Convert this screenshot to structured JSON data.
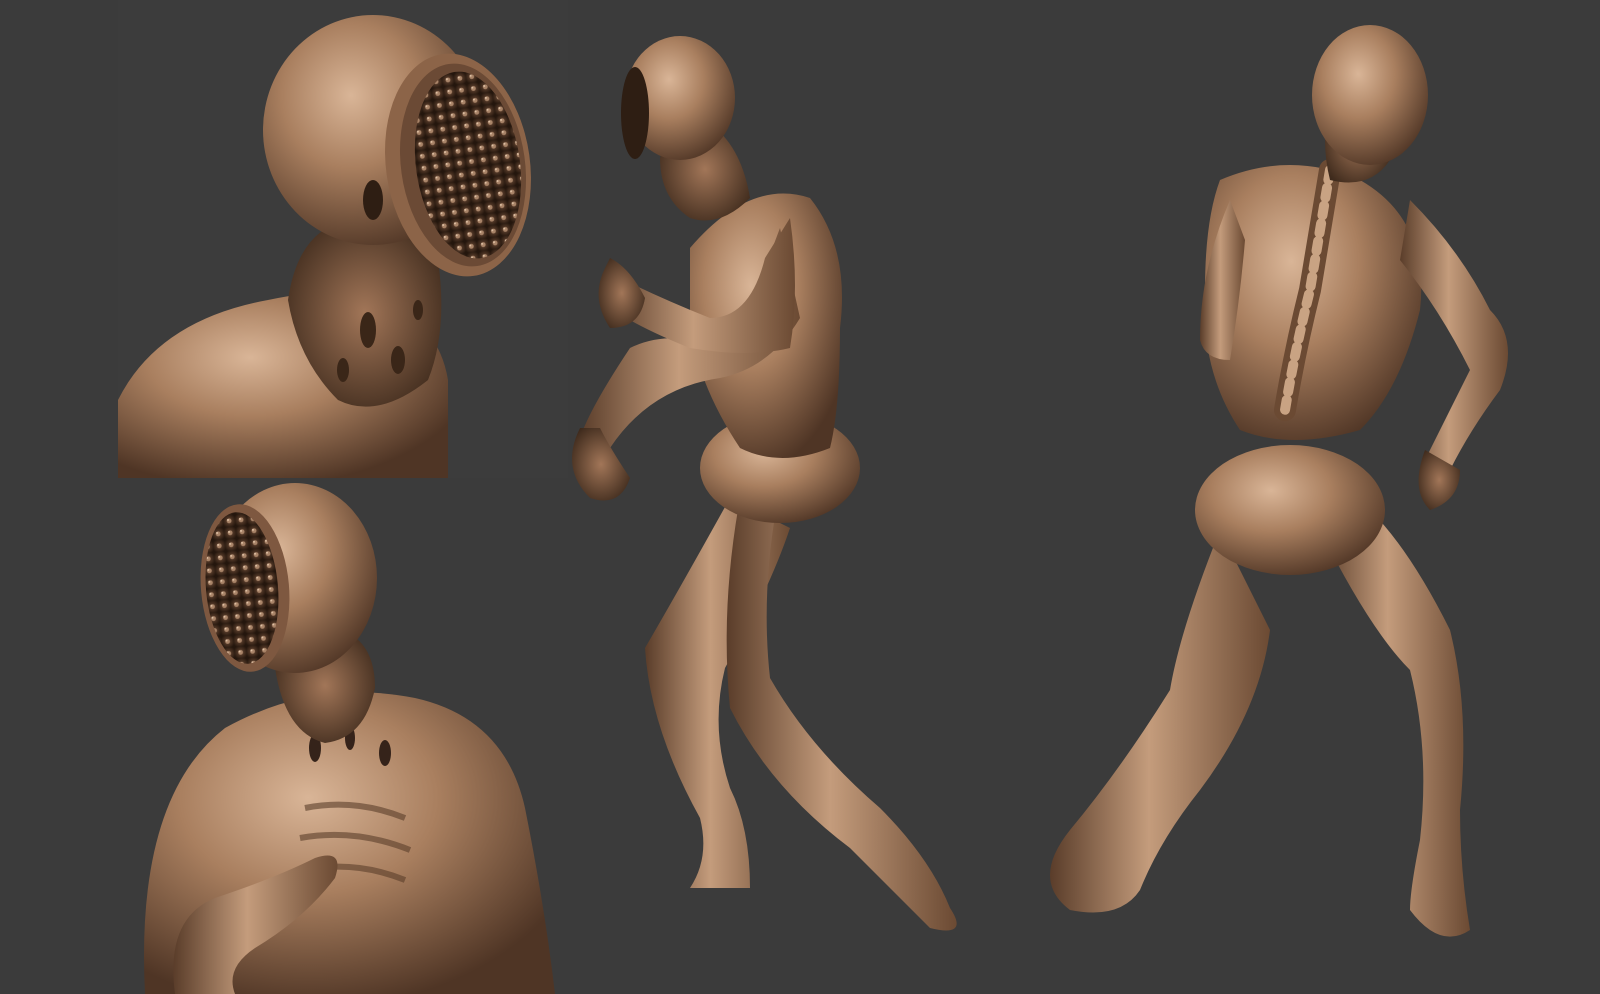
{
  "scene": {
    "background_color": "#3b3b3b",
    "skin_base_color": "#a0785a",
    "skin_highlight_color": "#d8b494",
    "skin_shadow_color": "#4a3222",
    "mouth_interior_color": "#2a1a10"
  },
  "views": [
    {
      "id": "closeup-side"
    },
    {
      "id": "closeup-front"
    },
    {
      "id": "full-body-side"
    },
    {
      "id": "full-body-back"
    }
  ]
}
